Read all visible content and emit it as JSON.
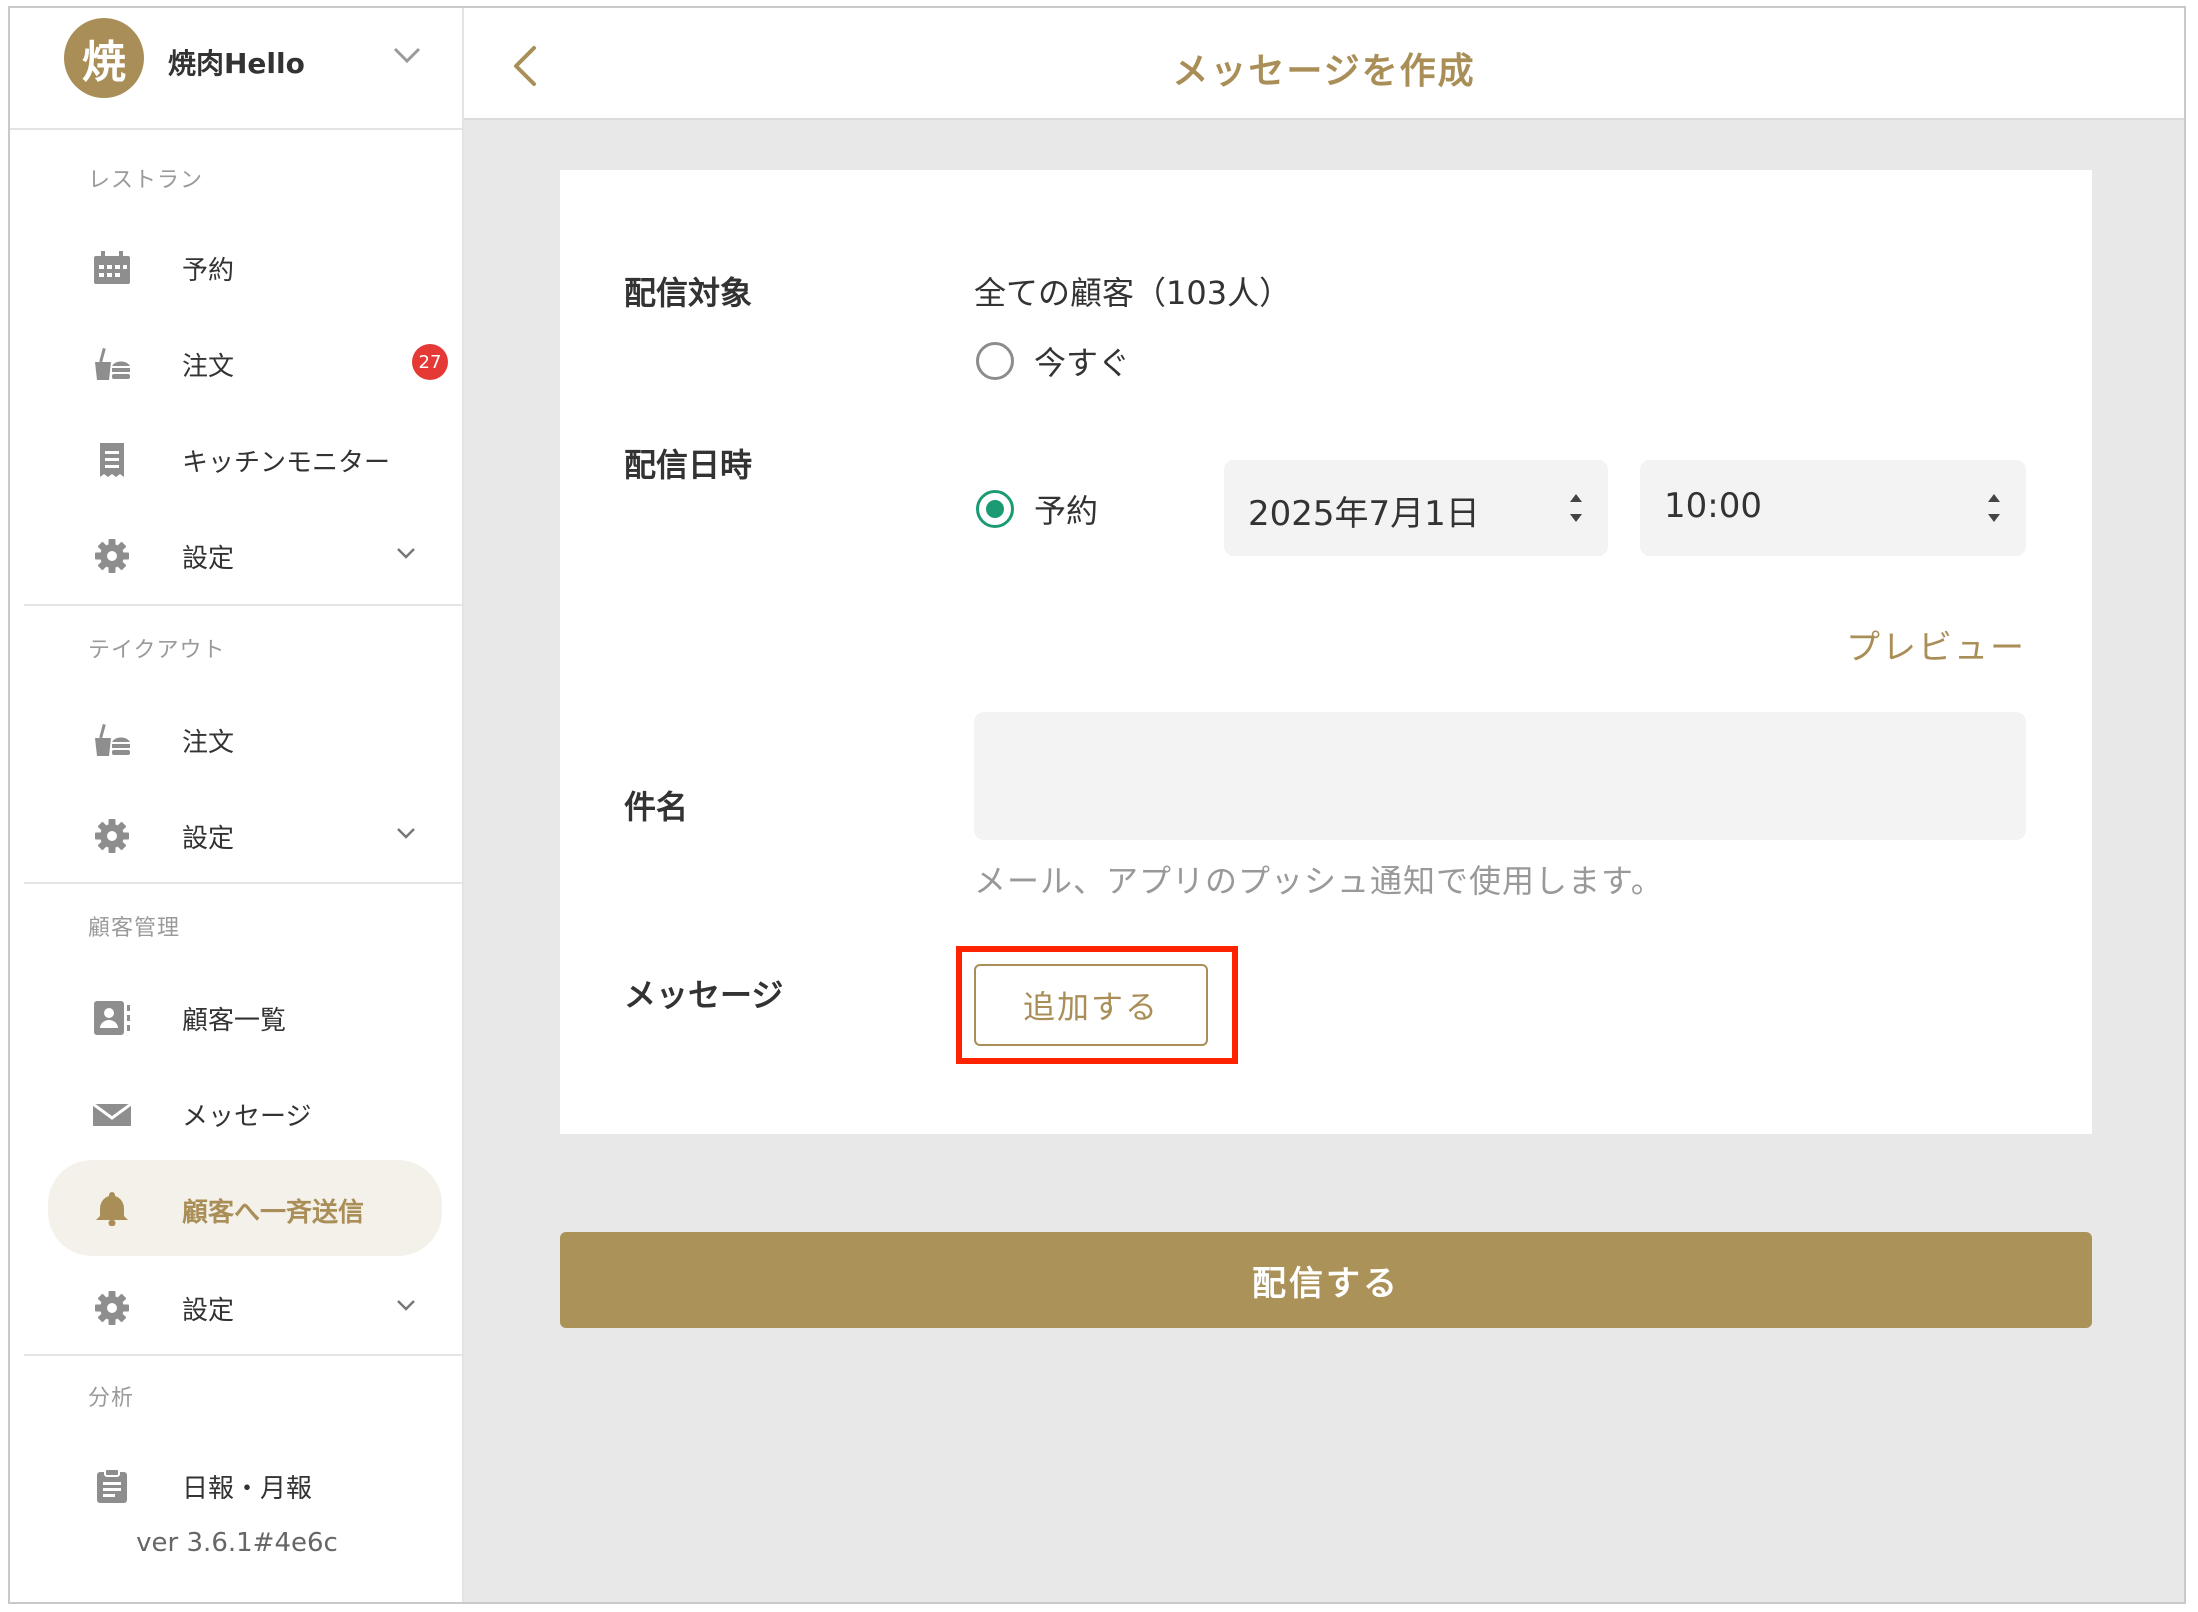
{
  "shop": {
    "avatar_char": "焼",
    "name": "焼肉Hello"
  },
  "sidebar": {
    "restaurant": {
      "title": "レストラン",
      "reserve": "予約",
      "orders": "注文",
      "orders_badge": "27",
      "kitchen": "キッチンモニター",
      "settings": "設定"
    },
    "takeout": {
      "title": "テイクアウト",
      "orders": "注文",
      "settings": "設定"
    },
    "customers": {
      "title": "顧客管理",
      "list": "顧客一覧",
      "messages": "メッセージ",
      "broadcast": "顧客へ一斉送信",
      "settings": "設定"
    },
    "analytics": {
      "title": "分析",
      "reports": "日報・月報"
    },
    "version": "ver 3.6.1#4e6c"
  },
  "header": {
    "title": "メッセージを作成"
  },
  "form": {
    "target_label": "配信対象",
    "target_value": "全ての顧客（103人）",
    "datetime_label": "配信日時",
    "now_label": "今すぐ",
    "schedule_label": "予約",
    "date_value": "2025年7月1日",
    "time_value": "10:00",
    "preview_label": "プレビュー",
    "subject_label": "件名",
    "subject_value": "",
    "subject_hint": "メール、アプリのプッシュ通知で使用します。",
    "message_label": "メッセージ",
    "add_label": "追加する",
    "send_label": "配信する"
  },
  "colors": {
    "accent": "#a98f57",
    "radio_checked": "#1a9b74",
    "badge": "#e53935",
    "highlight": "#ff2200"
  }
}
